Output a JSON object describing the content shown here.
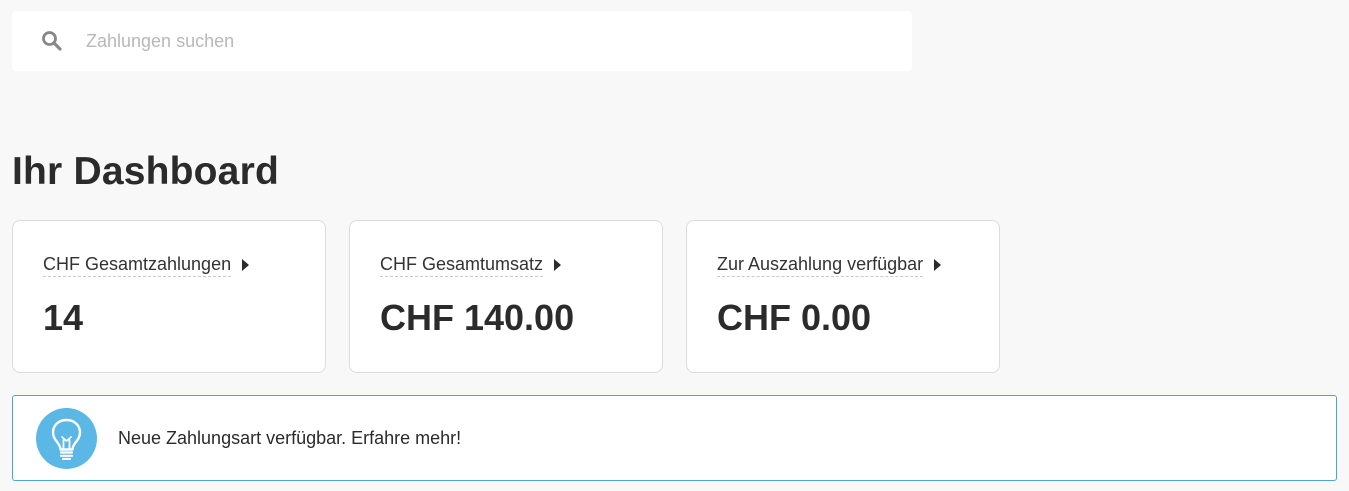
{
  "search": {
    "placeholder": "Zahlungen suchen",
    "value": "",
    "icon": "search-icon"
  },
  "dashboard": {
    "title": "Ihr Dashboard",
    "cards": [
      {
        "label": "CHF Gesamtzahlungen",
        "value": "14",
        "icon": "caret-right-icon"
      },
      {
        "label": "CHF Gesamtumsatz",
        "value": "CHF 140.00",
        "icon": "caret-right-icon"
      },
      {
        "label": "Zur Auszahlung verfügbar",
        "value": "CHF 0.00",
        "icon": "caret-right-icon"
      }
    ]
  },
  "notice": {
    "text": "Neue Zahlungsart verfügbar. Erfahre mehr!",
    "icon": "lightbulb-icon"
  },
  "colors": {
    "background": "#f8f8f8",
    "card_border": "#dcdcdc",
    "notice_border": "#4aa3df",
    "bulb_circle": "#5bb7e6",
    "text": "#2b2b2b"
  }
}
